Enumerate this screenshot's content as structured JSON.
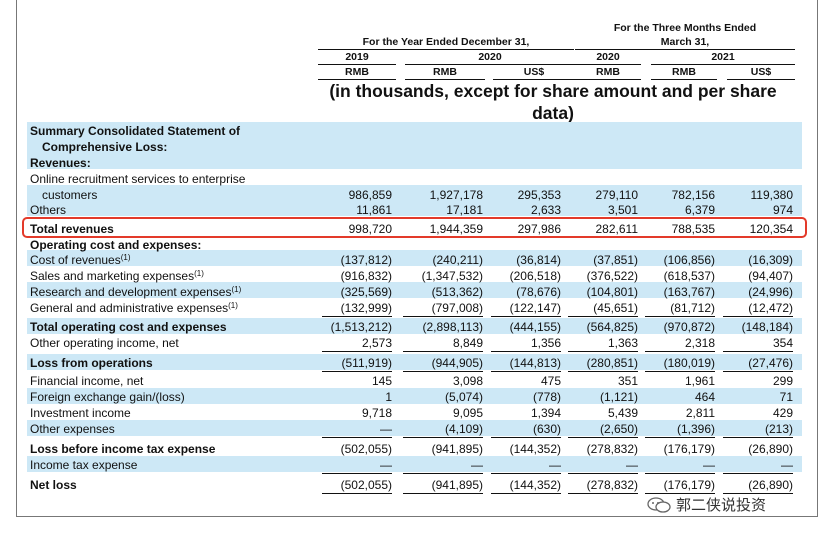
{
  "header": {
    "group_year": "For the Year Ended December 31,",
    "group_3m_line1": "For the Three Months Ended",
    "group_3m_line2": "March 31,",
    "year_2019": "2019",
    "year_2020": "2020",
    "q_2020": "2020",
    "q_2021": "2021",
    "cur": [
      "RMB",
      "RMB",
      "US$",
      "RMB",
      "RMB",
      "US$"
    ],
    "note": "(in thousands, except for share amount and per share data)"
  },
  "rows": [
    {
      "label": "Summary Consolidated Statement of",
      "bold": true,
      "values": []
    },
    {
      "label": "Comprehensive Loss:",
      "bold": true,
      "indent": true,
      "values": []
    },
    {
      "label": "Revenues:",
      "bold": true,
      "values": []
    },
    {
      "label": "Online recruitment services to enterprise",
      "values": []
    },
    {
      "label": "customers",
      "indent": true,
      "values": [
        "986,859",
        "1,927,178",
        "295,353",
        "279,110",
        "782,156",
        "119,380"
      ]
    },
    {
      "label": "Others",
      "values": [
        "11,861",
        "17,181",
        "2,633",
        "3,501",
        "6,379",
        "974"
      ],
      "ul": true
    },
    {
      "label": "Total revenues",
      "bold": true,
      "values": [
        "998,720",
        "1,944,359",
        "297,986",
        "282,611",
        "788,535",
        "120,354"
      ]
    },
    {
      "label": "Operating cost and expenses:",
      "bold": true,
      "values": []
    },
    {
      "label": "Cost of revenues",
      "sup": "(1)",
      "values": [
        "(137,812)",
        "(240,211)",
        "(36,814)",
        "(37,851)",
        "(106,856)",
        "(16,309)"
      ]
    },
    {
      "label": "Sales and marketing expenses",
      "sup": "(1)",
      "values": [
        "(916,832)",
        "(1,347,532)",
        "(206,518)",
        "(376,522)",
        "(618,537)",
        "(94,407)"
      ]
    },
    {
      "label": "Research and development expenses",
      "sup": "(1)",
      "values": [
        "(325,569)",
        "(513,362)",
        "(78,676)",
        "(104,801)",
        "(163,767)",
        "(24,996)"
      ]
    },
    {
      "label": "General and administrative expenses",
      "sup": "(1)",
      "values": [
        "(132,999)",
        "(797,008)",
        "(122,147)",
        "(45,651)",
        "(81,712)",
        "(12,472)"
      ],
      "ul": true
    },
    {
      "label": "Total operating cost and expenses",
      "bold": true,
      "values": [
        "(1,513,212)",
        "(2,898,113)",
        "(444,155)",
        "(564,825)",
        "(970,872)",
        "(148,184)"
      ]
    },
    {
      "label": "Other operating income, net",
      "values": [
        "2,573",
        "8,849",
        "1,356",
        "1,363",
        "2,318",
        "354"
      ],
      "ul": true
    },
    {
      "label": "Loss from operations",
      "bold": true,
      "values": [
        "(511,919)",
        "(944,905)",
        "(144,813)",
        "(280,851)",
        "(180,019)",
        "(27,476)"
      ],
      "ul": true
    },
    {
      "label": "Financial income, net",
      "values": [
        "145",
        "3,098",
        "475",
        "351",
        "1,961",
        "299"
      ]
    },
    {
      "label": "Foreign exchange gain/(loss)",
      "values": [
        "1",
        "(5,074)",
        "(778)",
        "(1,121)",
        "464",
        "71"
      ]
    },
    {
      "label": "Investment income",
      "values": [
        "9,718",
        "9,095",
        "1,394",
        "5,439",
        "2,811",
        "429"
      ]
    },
    {
      "label": "Other expenses",
      "values": [
        "—",
        "(4,109)",
        "(630)",
        "(2,650)",
        "(1,396)",
        "(213)"
      ],
      "ul": true
    },
    {
      "label": "Loss before income tax expense",
      "bold": true,
      "values": [
        "(502,055)",
        "(941,895)",
        "(144,352)",
        "(278,832)",
        "(176,179)",
        "(26,890)"
      ]
    },
    {
      "label": "Income tax expense",
      "values": [
        "—",
        "—",
        "—",
        "—",
        "—",
        "—"
      ],
      "ul": true
    },
    {
      "label": "Net loss",
      "bold": true,
      "values": [
        "(502,055)",
        "(941,895)",
        "(144,352)",
        "(278,832)",
        "(176,179)",
        "(26,890)"
      ],
      "ul": true
    }
  ],
  "watermark": "郭二侠说投资",
  "colors": {
    "band": "#cde8f6",
    "highlight": "#e33a2a"
  }
}
